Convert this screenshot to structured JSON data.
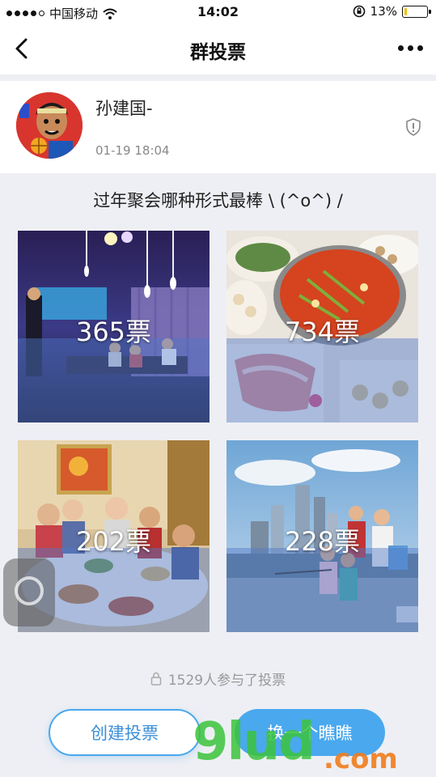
{
  "status_bar": {
    "carrier": "中国移动",
    "time": "14:02",
    "battery_percent": "13%",
    "battery_level": 0.13
  },
  "nav": {
    "title": "群投票",
    "back_icon": "chevron-left-icon",
    "more_icon": "more-dots-icon"
  },
  "author": {
    "name": "孙建国-",
    "time": "01-19 18:04"
  },
  "poll": {
    "question": "过年聚会哪种形式最棒 \\ (^o^) /",
    "options": [
      {
        "votes_label": "365票"
      },
      {
        "votes_label": "734票"
      },
      {
        "votes_label": "202票"
      },
      {
        "votes_label": "228票"
      }
    ],
    "participants": "1529人参与了投票"
  },
  "actions": {
    "create": "创建投票",
    "next": "换一个瞧瞧"
  },
  "watermark": {
    "brand": "9lud",
    "domain": ".com"
  },
  "colors": {
    "accent": "#4aa8ee",
    "background": "#eeeff4",
    "watermark_green": "#3cc43c",
    "watermark_orange": "#f07d1e"
  }
}
